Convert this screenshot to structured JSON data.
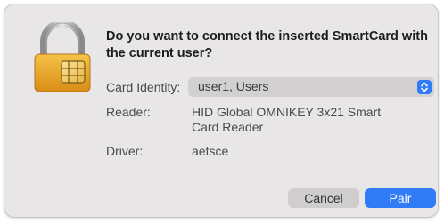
{
  "dialog": {
    "title": "Do you want to connect the inserted SmartCard with the current user?",
    "icon": "smartcard-lock-icon"
  },
  "fields": {
    "card_identity_label": "Card Identity:",
    "card_identity_value": "user1, Users",
    "reader_label": "Reader:",
    "reader_value_line1": "HID Global OMNIKEY 3x21 Smart",
    "reader_value_line2": "Card Reader",
    "driver_label": "Driver:",
    "driver_value": "aetsce"
  },
  "buttons": {
    "cancel_label": "Cancel",
    "pair_label": "Pair"
  },
  "colors": {
    "accent": "#2f7cf6",
    "dialog_bg": "#e8e6e6",
    "lock_gold": "#e6a92a"
  }
}
